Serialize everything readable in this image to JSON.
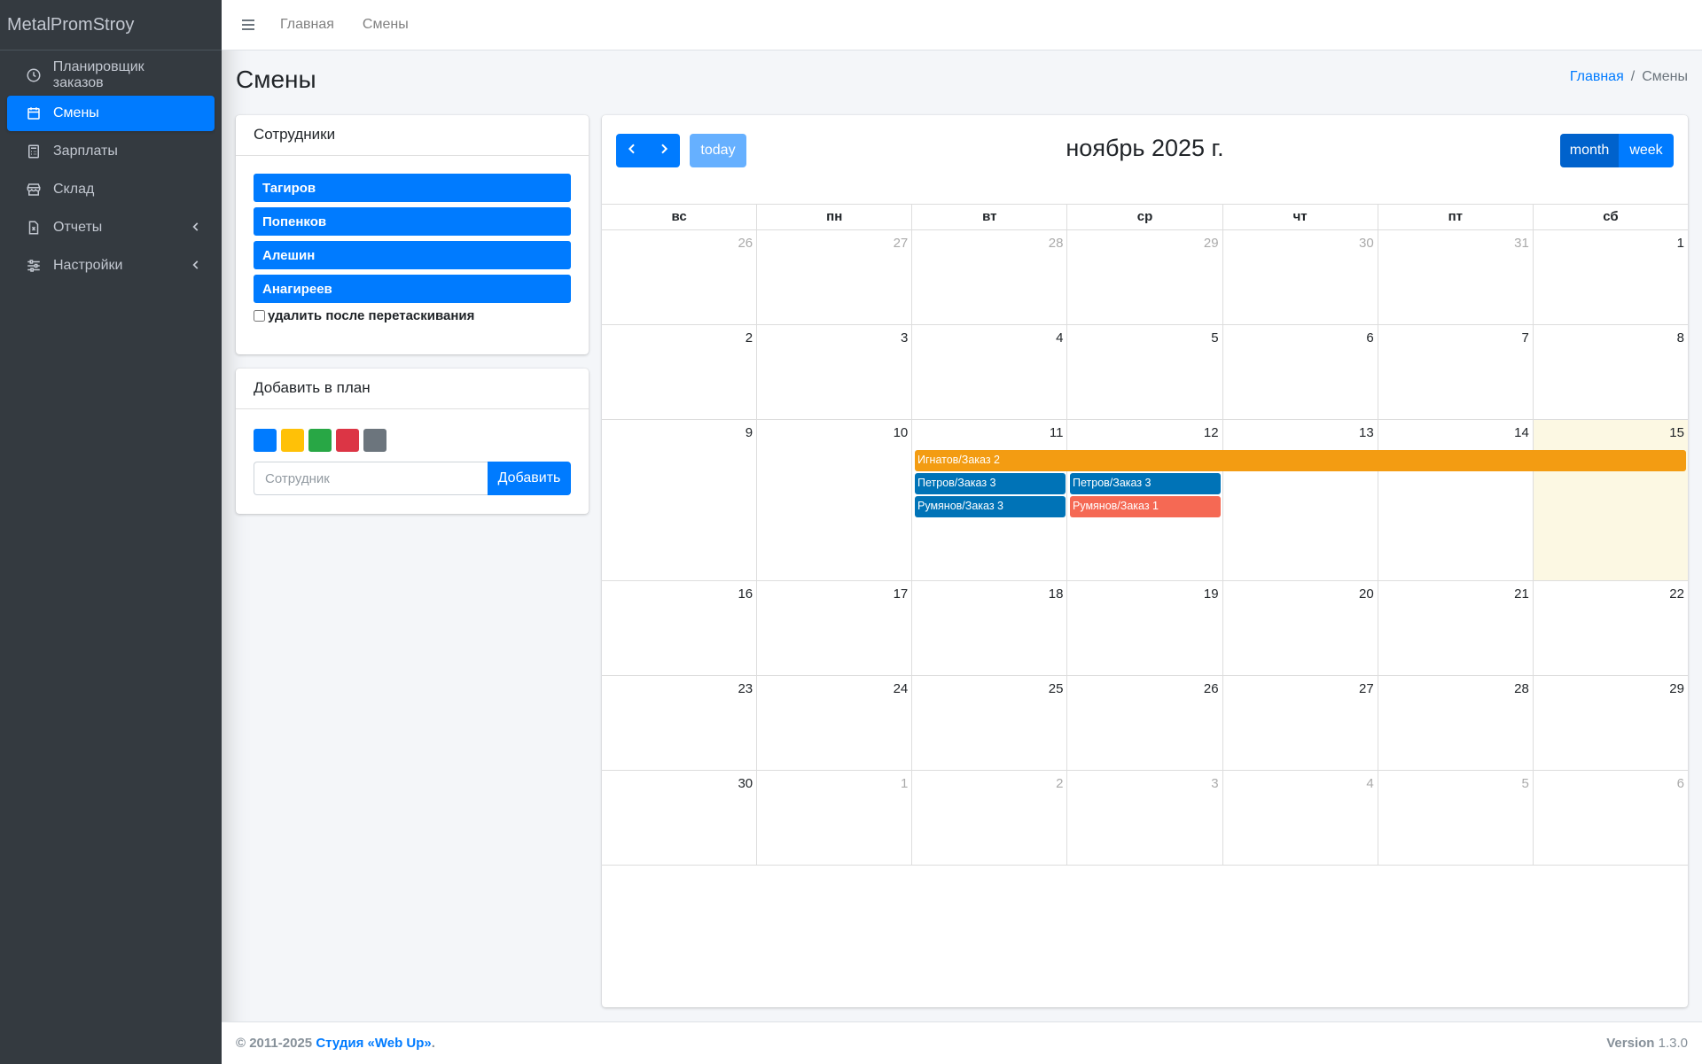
{
  "brand": "MetalPromStroy",
  "sidebar": {
    "items": [
      {
        "label": "Планировщик заказов",
        "icon": "clock-icon"
      },
      {
        "label": "Смены",
        "icon": "calendar-icon"
      },
      {
        "label": "Зарплаты",
        "icon": "calculator-icon"
      },
      {
        "label": "Склад",
        "icon": "store-icon"
      },
      {
        "label": "Отчеты",
        "icon": "file-excel-icon"
      },
      {
        "label": "Настройки",
        "icon": "sliders-icon"
      }
    ]
  },
  "topbar": {
    "home": "Главная",
    "shifts": "Смены"
  },
  "page": {
    "title": "Смены"
  },
  "breadcrumb": {
    "home": "Главная",
    "sep": "/",
    "current": "Смены"
  },
  "employees": {
    "title": "Сотрудники",
    "list": [
      "Тагиров",
      "Попенков",
      "Алешин",
      "Анагиреев"
    ],
    "remove_after_drop": "удалить после перетаскивания"
  },
  "add_plan": {
    "title": "Добавить в план",
    "colors": [
      "#007bff",
      "#ffc107",
      "#28a745",
      "#dc3545",
      "#6c757d"
    ],
    "placeholder": "Сотрудник",
    "button": "Добавить"
  },
  "calendar": {
    "title": "ноябрь 2025 г.",
    "today_label": "today",
    "month_label": "month",
    "week_label": "week",
    "days_of_week": [
      "вс",
      "пн",
      "вт",
      "ср",
      "чт",
      "пт",
      "сб"
    ],
    "weeks": [
      [
        26,
        27,
        28,
        29,
        30,
        31,
        1
      ],
      [
        2,
        3,
        4,
        5,
        6,
        7,
        8
      ],
      [
        9,
        10,
        11,
        12,
        13,
        14,
        15
      ],
      [
        16,
        17,
        18,
        19,
        20,
        21,
        22
      ],
      [
        23,
        24,
        25,
        26,
        27,
        28,
        29
      ],
      [
        30,
        1,
        2,
        3,
        4,
        5,
        6
      ]
    ],
    "today_date": "2025-11-15",
    "events": [
      {
        "title": "Игнатов/Заказ 2",
        "start": "2025-11-11",
        "end": "2025-11-15",
        "color": "#f39c12"
      },
      {
        "title": "Петров/Заказ 3",
        "start": "2025-11-11",
        "end": "2025-11-11",
        "color": "#0073b7"
      },
      {
        "title": "Петров/Заказ 3",
        "start": "2025-11-12",
        "end": "2025-11-12",
        "color": "#0073b7"
      },
      {
        "title": "Румянов/Заказ 3",
        "start": "2025-11-11",
        "end": "2025-11-11",
        "color": "#0073b7"
      },
      {
        "title": "Румянов/Заказ 1",
        "start": "2025-11-12",
        "end": "2025-11-12",
        "color": "#f56954"
      }
    ]
  },
  "footer": {
    "copyright": "© 2011-2025",
    "studio": "Студия «Web Up»",
    "dot": ".",
    "version_label": "Version",
    "version": "1.3.0"
  }
}
